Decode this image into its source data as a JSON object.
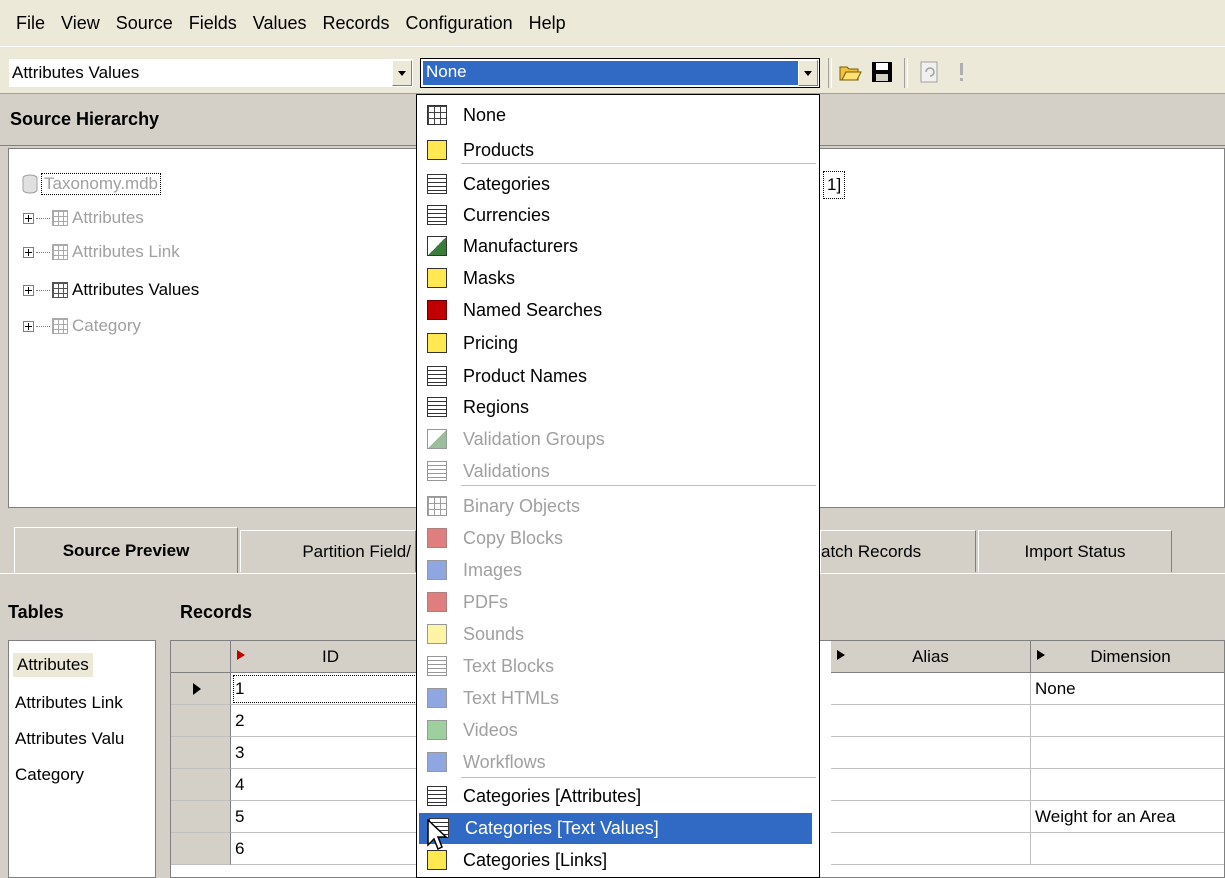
{
  "menu": [
    "File",
    "View",
    "Source",
    "Fields",
    "Values",
    "Records",
    "Configuration",
    "Help"
  ],
  "toolbar": {
    "table_combo_value": "Attributes Values",
    "lookup_combo_value": "None"
  },
  "hierarchy": {
    "title": "Source Hierarchy",
    "root": "Taxonomy.mdb",
    "nodes": [
      "Attributes",
      "Attributes Link",
      "Attributes Values",
      "Category"
    ],
    "right_fragment": "1]"
  },
  "tabs": [
    "Source Preview",
    "Partition Field/",
    "atch Records",
    "Import Status"
  ],
  "tables": {
    "title": "Tables",
    "items": [
      "Attributes",
      "Attributes Link",
      "Attributes Valu",
      "Category"
    ]
  },
  "records": {
    "title": "Records",
    "columns": [
      "ID",
      "Alias",
      "Dimension"
    ],
    "rows": [
      {
        "id": "1",
        "dimension": "None"
      },
      {
        "id": "2",
        "dimension": ""
      },
      {
        "id": "3",
        "dimension": ""
      },
      {
        "id": "4",
        "dimension": ""
      },
      {
        "id": "5",
        "dimension": "Weight for an Area"
      },
      {
        "id": "6",
        "dimension": ""
      }
    ]
  },
  "dropdown": {
    "items": [
      {
        "label": "None",
        "enabled": true,
        "icon": "grid-icon"
      },
      {
        "label": "Products",
        "enabled": true,
        "icon": "products-icon"
      },
      {
        "label": "Categories",
        "enabled": true,
        "icon": "categories-icon"
      },
      {
        "label": "Currencies",
        "enabled": true,
        "icon": "document-icon"
      },
      {
        "label": "Manufacturers",
        "enabled": true,
        "icon": "manufacturers-icon"
      },
      {
        "label": "Masks",
        "enabled": true,
        "icon": "mask-icon"
      },
      {
        "label": "Named Searches",
        "enabled": true,
        "icon": "gear-icon"
      },
      {
        "label": "Pricing",
        "enabled": true,
        "icon": "pricing-icon"
      },
      {
        "label": "Product Names",
        "enabled": true,
        "icon": "document-icon"
      },
      {
        "label": "Regions",
        "enabled": true,
        "icon": "document-icon"
      },
      {
        "label": "Validation Groups",
        "enabled": false,
        "icon": "validation-groups-icon"
      },
      {
        "label": "Validations",
        "enabled": false,
        "icon": "validations-icon"
      },
      {
        "label": "Binary Objects",
        "enabled": false,
        "icon": "binary-icon"
      },
      {
        "label": "Copy Blocks",
        "enabled": false,
        "icon": "copy-blocks-icon"
      },
      {
        "label": "Images",
        "enabled": false,
        "icon": "image-icon"
      },
      {
        "label": "PDFs",
        "enabled": false,
        "icon": "pdf-icon"
      },
      {
        "label": "Sounds",
        "enabled": false,
        "icon": "sound-icon"
      },
      {
        "label": "Text Blocks",
        "enabled": false,
        "icon": "document-icon"
      },
      {
        "label": "Text HTMLs",
        "enabled": false,
        "icon": "html-icon"
      },
      {
        "label": "Videos",
        "enabled": false,
        "icon": "video-icon"
      },
      {
        "label": "Workflows",
        "enabled": false,
        "icon": "workflow-icon"
      },
      {
        "label": "Categories [Attributes]",
        "enabled": true,
        "icon": "category-attributes-icon"
      },
      {
        "label": "Categories [Text Values]",
        "enabled": true,
        "icon": "category-text-values-icon",
        "selected": true
      },
      {
        "label": "Categories [Links]",
        "enabled": true,
        "icon": "category-links-icon"
      }
    ]
  },
  "colors": {
    "selection": "#316ac5",
    "disabled_text": "#a0a0a0",
    "window_bg": "#d4d0c8"
  }
}
